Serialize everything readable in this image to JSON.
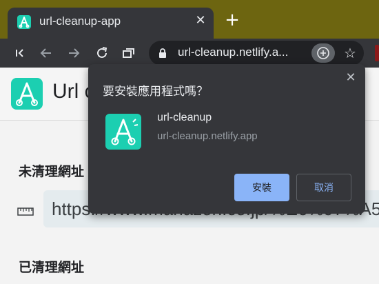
{
  "tab": {
    "title": "url-cleanup-app",
    "close_glyph": "✕"
  },
  "new_tab_glyph": "+",
  "toolbar": {
    "icons": [
      "collapse-tab-icon",
      "back-icon",
      "forward-icon",
      "reload-icon",
      "tab-search-icon"
    ],
    "address": "url-cleanup.netlify.a...",
    "star_glyph": "☆"
  },
  "page": {
    "app_name_partial": "Url c",
    "unclean_label": "未清理網址",
    "cleaned_label": "已清理網址",
    "input_value": "https://www.manazon.co.jp/%E6%97%A5%E6%9C%AC%E8"
  },
  "dialog": {
    "title": "要安裝應用程式嗎？",
    "app_name": "url-cleanup",
    "app_url": "url-cleanup.netlify.app",
    "install_label": "安裝",
    "cancel_label": "取消",
    "close_glyph": "✕"
  },
  "colors": {
    "accent": "#1ccfb1",
    "primary_button": "#8ab4f8",
    "dialog_bg": "#35363a",
    "tabstrip_bg": "#6d6510"
  }
}
